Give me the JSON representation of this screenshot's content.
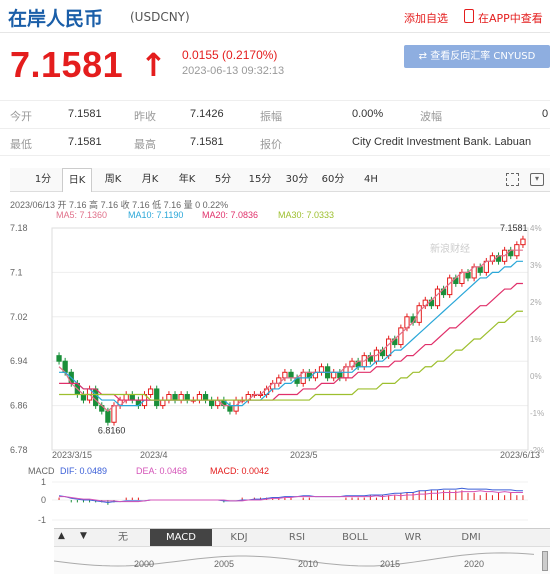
{
  "header": {
    "title": "在岸人民币",
    "code": "(USDCNY)",
    "add_watch": "添加自选",
    "app_view": "在APP中查看",
    "price": "7.1581",
    "change": "0.0155 (0.2170%)",
    "datetime": "2023-06-13 09:32:13",
    "convert_button": "查看反向汇率 CNYUSD"
  },
  "quote_table": {
    "row1": [
      {
        "label": "今开",
        "value": "7.1581"
      },
      {
        "label": "昨收",
        "value": "7.1426"
      },
      {
        "label": "振幅",
        "value": "0.00%"
      },
      {
        "label": "波幅",
        "value": "0"
      }
    ],
    "row2": [
      {
        "label": "最低",
        "value": "7.1581"
      },
      {
        "label": "最高",
        "value": "7.1581"
      },
      {
        "label": "报价",
        "value": "City Credit Investment Bank. Labuan"
      }
    ]
  },
  "tabs": [
    "1分",
    "日K",
    "周K",
    "月K",
    "年K",
    "5分",
    "15分",
    "30分",
    "60分",
    "4H"
  ],
  "active_tab": "日K",
  "chart_info": {
    "ohlc": "2023/06/13 开 7.16 高 7.16 收 7.16 低 7.16 量 0 0.22%",
    "ma5": "MA5: 7.1360",
    "ma10": "MA10: 7.1190",
    "ma20": "MA20: 7.0836",
    "ma30": "MA30: 7.0333",
    "macd_label": "MACD",
    "dif": "DIF: 0.0489",
    "dea": "DEA: 0.0468",
    "macd": "MACD: 0.0042",
    "watermark": "新浪财经"
  },
  "colors": {
    "up": "#e41d1d",
    "down": "#1a8f3a",
    "ma5": "#e0708a",
    "ma10": "#2aa7d8",
    "ma20": "#e0306a",
    "ma30": "#9dbf2e",
    "dif": "#3b5fd8",
    "dea": "#d454b8"
  },
  "bottom_tabs": [
    "无",
    "MACD",
    "KDJ",
    "RSI",
    "BOLL",
    "WR",
    "DMI"
  ],
  "active_bottom_tab": "MACD",
  "navigator_years": [
    "2000",
    "2005",
    "2010",
    "2015",
    "2020"
  ],
  "chart_data": {
    "type": "candlestick",
    "title": "",
    "y_ticks": [
      "7.18",
      "7.1",
      "7.02",
      "6.94",
      "6.86",
      "6.78"
    ],
    "y_right_ticks": [
      "4%",
      "3%",
      "2%",
      "1%",
      "0%",
      "-1%",
      "-2%"
    ],
    "x_ticks": [
      "2023/3/15",
      "2023/4",
      "2023/5",
      "2023/6/13"
    ],
    "ylim": [
      6.78,
      7.18
    ],
    "annotations": {
      "high": "7.1581",
      "low": "6.8160"
    },
    "macd_ticks": [
      "1",
      "0",
      "-1"
    ],
    "close_series": [
      6.94,
      6.92,
      6.9,
      6.88,
      6.87,
      6.89,
      6.86,
      6.85,
      6.83,
      6.86,
      6.87,
      6.88,
      6.87,
      6.86,
      6.88,
      6.89,
      6.86,
      6.87,
      6.88,
      6.87,
      6.88,
      6.87,
      6.87,
      6.88,
      6.87,
      6.86,
      6.87,
      6.86,
      6.85,
      6.87,
      6.87,
      6.88,
      6.88,
      6.88,
      6.89,
      6.9,
      6.91,
      6.92,
      6.91,
      6.9,
      6.92,
      6.91,
      6.92,
      6.93,
      6.91,
      6.92,
      6.91,
      6.93,
      6.94,
      6.93,
      6.95,
      6.94,
      6.96,
      6.95,
      6.98,
      6.97,
      7.0,
      7.02,
      7.01,
      7.04,
      7.05,
      7.04,
      7.07,
      7.06,
      7.09,
      7.08,
      7.1,
      7.09,
      7.11,
      7.1,
      7.12,
      7.13,
      7.12,
      7.14,
      7.13,
      7.15,
      7.16
    ],
    "ma5_series": [
      6.93,
      6.92,
      6.9,
      6.89,
      6.88,
      6.88,
      6.87,
      6.86,
      6.85,
      6.86,
      6.86,
      6.87,
      6.87,
      6.87,
      6.87,
      6.87,
      6.87,
      6.87,
      6.87,
      6.87,
      6.87,
      6.87,
      6.87,
      6.87,
      6.87,
      6.87,
      6.87,
      6.86,
      6.86,
      6.86,
      6.87,
      6.87,
      6.88,
      6.88,
      6.89,
      6.9,
      6.9,
      6.91,
      6.91,
      6.91,
      6.92,
      6.92,
      6.92,
      6.92,
      6.92,
      6.92,
      6.92,
      6.93,
      6.93,
      6.94,
      6.94,
      6.95,
      6.95,
      6.96,
      6.97,
      6.98,
      6.99,
      7.0,
      7.01,
      7.03,
      7.04,
      7.05,
      7.06,
      7.07,
      7.08,
      7.09,
      7.1,
      7.1,
      7.11,
      7.11,
      7.12,
      7.12,
      7.13,
      7.13,
      7.14,
      7.14,
      7.14
    ],
    "ma10_series": [
      6.92,
      6.92,
      6.91,
      6.9,
      6.89,
      6.89,
      6.88,
      6.87,
      6.87,
      6.87,
      6.86,
      6.86,
      6.86,
      6.86,
      6.87,
      6.87,
      6.87,
      6.87,
      6.87,
      6.87,
      6.87,
      6.87,
      6.87,
      6.87,
      6.87,
      6.87,
      6.87,
      6.87,
      6.86,
      6.86,
      6.86,
      6.87,
      6.87,
      6.87,
      6.88,
      6.89,
      6.89,
      6.9,
      6.9,
      6.91,
      6.91,
      6.91,
      6.92,
      6.92,
      6.92,
      6.92,
      6.92,
      6.92,
      6.92,
      6.93,
      6.93,
      6.93,
      6.94,
      6.94,
      6.95,
      6.96,
      6.96,
      6.97,
      6.98,
      6.99,
      7.0,
      7.01,
      7.02,
      7.03,
      7.04,
      7.05,
      7.06,
      7.07,
      7.08,
      7.09,
      7.09,
      7.1,
      7.1,
      7.11,
      7.11,
      7.12,
      7.12
    ],
    "ma20_series": [
      6.9,
      6.9,
      6.9,
      6.9,
      6.89,
      6.89,
      6.89,
      6.88,
      6.88,
      6.88,
      6.87,
      6.87,
      6.87,
      6.87,
      6.87,
      6.87,
      6.87,
      6.87,
      6.87,
      6.87,
      6.87,
      6.87,
      6.87,
      6.87,
      6.87,
      6.87,
      6.87,
      6.87,
      6.87,
      6.87,
      6.87,
      6.87,
      6.87,
      6.87,
      6.87,
      6.87,
      6.88,
      6.88,
      6.88,
      6.88,
      6.89,
      6.89,
      6.89,
      6.9,
      6.9,
      6.9,
      6.91,
      6.91,
      6.91,
      6.92,
      6.92,
      6.92,
      6.93,
      6.93,
      6.93,
      6.94,
      6.94,
      6.95,
      6.95,
      6.96,
      6.97,
      6.97,
      6.98,
      6.99,
      7.0,
      7.0,
      7.01,
      7.02,
      7.03,
      7.04,
      7.04,
      7.05,
      7.06,
      7.07,
      7.07,
      7.08,
      7.08
    ],
    "ma30_series": [
      6.88,
      6.88,
      6.88,
      6.88,
      6.88,
      6.88,
      6.88,
      6.88,
      6.88,
      6.88,
      6.88,
      6.88,
      6.88,
      6.88,
      6.88,
      6.87,
      6.87,
      6.87,
      6.87,
      6.87,
      6.87,
      6.87,
      6.87,
      6.87,
      6.87,
      6.87,
      6.87,
      6.87,
      6.87,
      6.87,
      6.87,
      6.87,
      6.87,
      6.87,
      6.87,
      6.87,
      6.87,
      6.87,
      6.87,
      6.87,
      6.87,
      6.87,
      6.88,
      6.88,
      6.88,
      6.88,
      6.88,
      6.88,
      6.88,
      6.89,
      6.89,
      6.89,
      6.89,
      6.9,
      6.9,
      6.9,
      6.91,
      6.91,
      6.92,
      6.92,
      6.93,
      6.93,
      6.94,
      6.94,
      6.95,
      6.96,
      6.96,
      6.97,
      6.98,
      6.98,
      6.99,
      7.0,
      7.01,
      7.01,
      7.02,
      7.03,
      7.03
    ]
  }
}
